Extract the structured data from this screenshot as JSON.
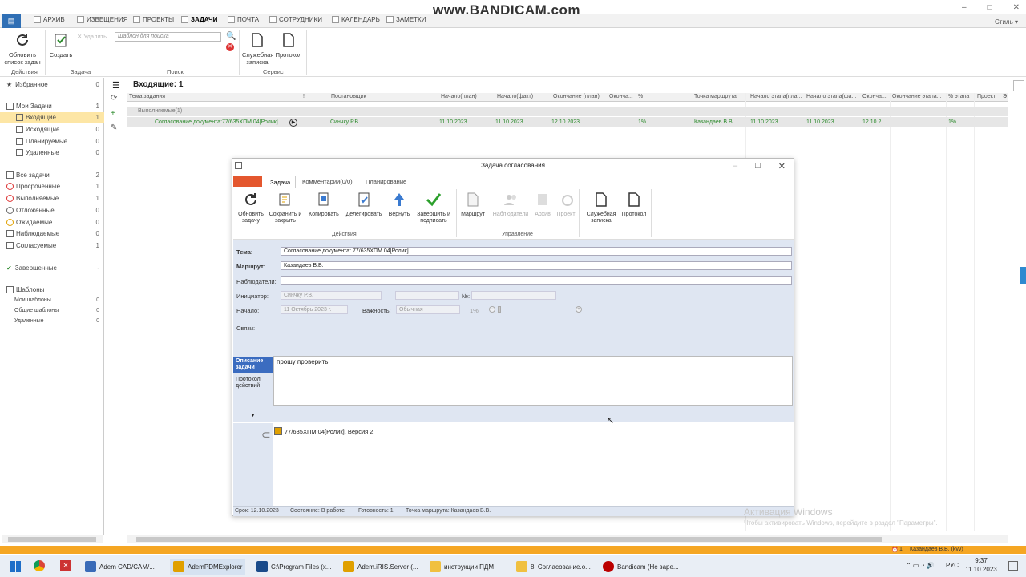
{
  "watermark": "www.BANDICAM.com",
  "window_controls": [
    "–",
    "□",
    "✕"
  ],
  "style_label": "Стиль ▾",
  "tabs": [
    {
      "label": "АРХИВ",
      "active": false
    },
    {
      "label": "ИЗВЕЩЕНИЯ",
      "active": false
    },
    {
      "label": "ПРОЕКТЫ",
      "active": false
    },
    {
      "label": "ЗАДАЧИ",
      "active": true
    },
    {
      "label": "ПОЧТА",
      "active": false
    },
    {
      "label": "СОТРУДНИКИ",
      "active": false
    },
    {
      "label": "КАЛЕНДАРЬ",
      "active": false
    },
    {
      "label": "ЗАМЕТКИ",
      "active": false
    }
  ],
  "ribbon": {
    "refresh_label": "Обновить список задач",
    "create_label": "Создать",
    "delete_label": "Удалить",
    "search_placeholder": "Шаблон для поиска",
    "memo_label": "Служебная записка",
    "protocol_label": "Протокол",
    "groups": {
      "actions": "Действия",
      "task": "Задача",
      "search": "Поиск",
      "service": "Сервис"
    }
  },
  "leftnav": {
    "favorites": {
      "label": "Избранное",
      "count": "0"
    },
    "my_tasks": {
      "label": "Мои Задачи",
      "count": "1"
    },
    "incoming": {
      "label": "Входящие",
      "count": "1"
    },
    "outgoing": {
      "label": "Исходящие",
      "count": "0"
    },
    "planned": {
      "label": "Планируемые",
      "count": "0"
    },
    "deleted": {
      "label": "Удаленные",
      "count": "0"
    },
    "all_tasks": {
      "label": "Все задачи",
      "count": "2"
    },
    "overdue": {
      "label": "Просроченные",
      "count": "1"
    },
    "in_progress": {
      "label": "Выполняемые",
      "count": "1"
    },
    "postponed": {
      "label": "Отложенные",
      "count": "0"
    },
    "waiting": {
      "label": "Ожидаемые",
      "count": "0"
    },
    "observed": {
      "label": "Наблюдаемые",
      "count": "0"
    },
    "approving": {
      "label": "Согласуемые",
      "count": "1"
    },
    "completed": {
      "label": "Завершенные",
      "count": "-"
    },
    "templates": {
      "label": "Шаблоны"
    },
    "my_templates": {
      "label": "Мои шаблоны",
      "count": "0"
    },
    "common_templates": {
      "label": "Общие шаблоны",
      "count": "0"
    },
    "deleted_templates": {
      "label": "Удаленные",
      "count": "0"
    }
  },
  "grid": {
    "title": "Входящие: 1",
    "columns": [
      "Тема задания",
      "!",
      "Постановщик",
      "Начало(план)",
      "Начало(факт)",
      "Окончание (план)",
      "Оконча...",
      "%",
      "Точка маршрута",
      "Начало этапа(пла...",
      "Начало этапа(фа...",
      "Оконча...",
      "Окончание этапа...",
      "% этапа",
      "Проект",
      "Э"
    ],
    "group_label": "Выполняемые(1)",
    "row": {
      "subject": "Согласование документа:77/635ХПМ.04[Ролик]",
      "author": "Синчку Р.В.",
      "start_plan": "11.10.2023",
      "start_fact": "11.10.2023",
      "end_plan": "12.10.2023",
      "percent": "1%",
      "route_point": "Казандаев В.В.",
      "stage_start_plan": "11.10.2023",
      "stage_start_fact": "11.10.2023",
      "stage_end": "12.10.2...",
      "stage_percent": "1%"
    }
  },
  "dialog": {
    "title": "Задача согласования",
    "tabs": [
      "Задача",
      "Комментарии(0/0)",
      "Планирование"
    ],
    "buttons": {
      "refresh": "Обновить задачу",
      "save_close": "Сохранить и закрыть",
      "copy": "Копировать",
      "delegate": "Делегировать",
      "return": "Вернуть",
      "finish_sign": "Завершить и подписать",
      "route": "Маршрут",
      "observers": "Наблюдатели",
      "archive": "Архив",
      "project": "Проект",
      "memo": "Служебная записка",
      "protocol": "Протокол"
    },
    "groups": {
      "actions": "Действия",
      "management": "Управление"
    },
    "form": {
      "topic_label": "Тема:",
      "topic_value": "Согласование документа: 77/635ХПМ.04[Ролик]",
      "route_label": "Маршрут:",
      "route_value": "Казандаев В.В.",
      "observers_label": "Наблюдатели:",
      "initiator_label": "Инициатор:",
      "initiator_value": "Синчку Р.В.",
      "number_label": "№:",
      "start_label": "Начало:",
      "start_value": "11 Октябрь 2023 г.",
      "importance_label": "Важность:",
      "importance_value": "Обычная",
      "percent_value": "1%",
      "links_label": "Связи:"
    },
    "side_tabs": [
      "Описание задачи",
      "Протокол действий"
    ],
    "description": "прошу проверить",
    "attachment": "77/635ХПМ.04[Ролик], Версия 2",
    "status": {
      "due": "Срок: 12.10.2023",
      "state": "Состояние: В работе",
      "ready": "Готовность: 1",
      "route_point": "Точка маршрута: Казандаев В.В."
    }
  },
  "activation": {
    "title": "Активация Windows",
    "subtitle": "Чтобы активировать Windows, перейдите в раздел \"Параметры\"."
  },
  "bottom_user": "Казандаев В.В. (kvv)",
  "bottom_count": "1",
  "taskbar": {
    "items": [
      "Adem CAD/CAM/...",
      "AdemPDMExplorer",
      "C:\\Program Files (x...",
      "Adem.iRIS.Server (...",
      "инструкции ПДМ",
      "8. Согласование.о...",
      "Bandicam (Не заре..."
    ],
    "lang": "РУС",
    "time": "9:37",
    "date": "11.10.2023"
  },
  "colors": {
    "accent": "#2f6fb5",
    "green_text": "#2c8a2c",
    "orange": "#f5a623",
    "form_bg": "#dfe6f2"
  }
}
